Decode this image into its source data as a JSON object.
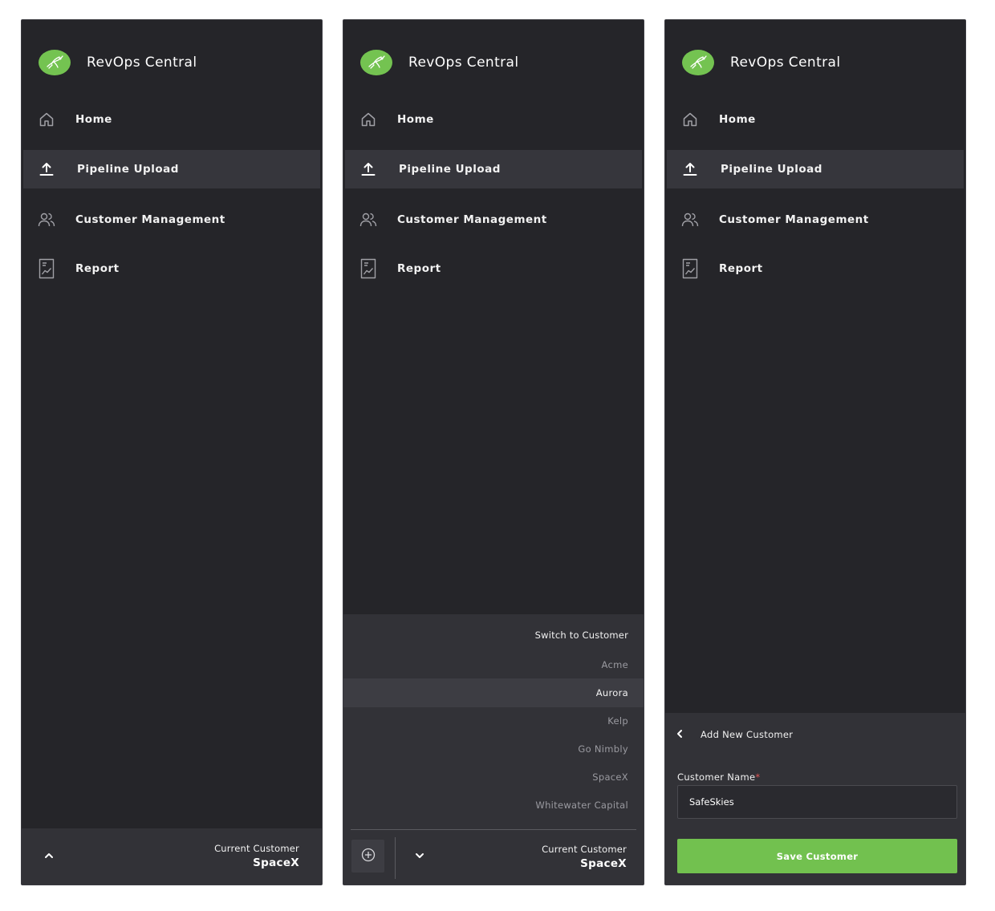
{
  "app": {
    "title": "RevOps Central",
    "accent_color": "#74c351",
    "logo_icon": "hummingbird-logo"
  },
  "nav": {
    "items": [
      {
        "label": "Home",
        "icon": "home-icon",
        "active": false
      },
      {
        "label": "Pipeline Upload",
        "icon": "upload-icon",
        "active": true
      },
      {
        "label": "Customer Management",
        "icon": "users-icon",
        "active": false
      },
      {
        "label": "Report",
        "icon": "report-icon",
        "active": false
      }
    ]
  },
  "footer": {
    "current_customer_label": "Current Customer",
    "current_customer_value": "SpaceX",
    "expand_icon": "chevron-up-icon"
  },
  "switcher": {
    "header": "Switch to Customer",
    "customers": [
      "Acme",
      "Aurora",
      "Kelp",
      "Go Nimbly",
      "SpaceX",
      "Whitewater Capital"
    ],
    "highlighted": "Aurora",
    "add_icon": "plus-circle-icon",
    "collapse_icon": "chevron-down-icon",
    "current_customer_label": "Current Customer",
    "current_customer_value": "SpaceX"
  },
  "add_customer": {
    "title": "Add New Customer",
    "back_icon": "chevron-left-icon",
    "field_label": "Customer Name",
    "required_mark": "*",
    "field_value": "SafeSkies",
    "save_label": "Save Customer",
    "save_color": "#72c14f"
  }
}
